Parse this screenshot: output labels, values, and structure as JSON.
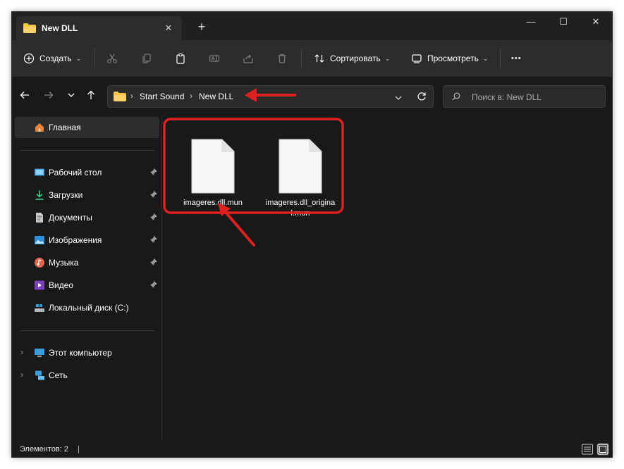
{
  "window": {
    "tab_title": "New DLL",
    "tab_close": "✕",
    "new_tab": "+",
    "minimize": "—",
    "maximize": "☐",
    "close": "✕"
  },
  "toolbar": {
    "create_label": "Создать",
    "sort_label": "Сортировать",
    "view_label": "Просмотреть",
    "more_label": "•••",
    "chevron": "⌄"
  },
  "address": {
    "breadcrumbs": [
      "Start Sound",
      "New DLL"
    ],
    "separator": "›",
    "search_placeholder": "Поиск в: New DLL"
  },
  "sidebar": {
    "home": "Главная",
    "quick_access": [
      {
        "label": "Рабочий стол",
        "icon": "desktop-icon",
        "pinned": true
      },
      {
        "label": "Загрузки",
        "icon": "downloads-icon",
        "pinned": true
      },
      {
        "label": "Документы",
        "icon": "documents-icon",
        "pinned": true
      },
      {
        "label": "Изображения",
        "icon": "pictures-icon",
        "pinned": true
      },
      {
        "label": "Музыка",
        "icon": "music-icon",
        "pinned": true
      },
      {
        "label": "Видео",
        "icon": "video-icon",
        "pinned": true
      },
      {
        "label": "Локальный диск (C:)",
        "icon": "drive-icon",
        "pinned": false
      }
    ],
    "this_pc": "Этот компьютер",
    "network": "Сеть",
    "expand_glyph": "›"
  },
  "files": [
    {
      "name": "imageres.dll.mun"
    },
    {
      "name": "imageres.dll_original.mun"
    }
  ],
  "status": {
    "items_count": "Элементов: 2",
    "caret": "|"
  },
  "colors": {
    "annotation": "#e02020",
    "folder": "#f6c342",
    "window_bg": "#191919"
  }
}
